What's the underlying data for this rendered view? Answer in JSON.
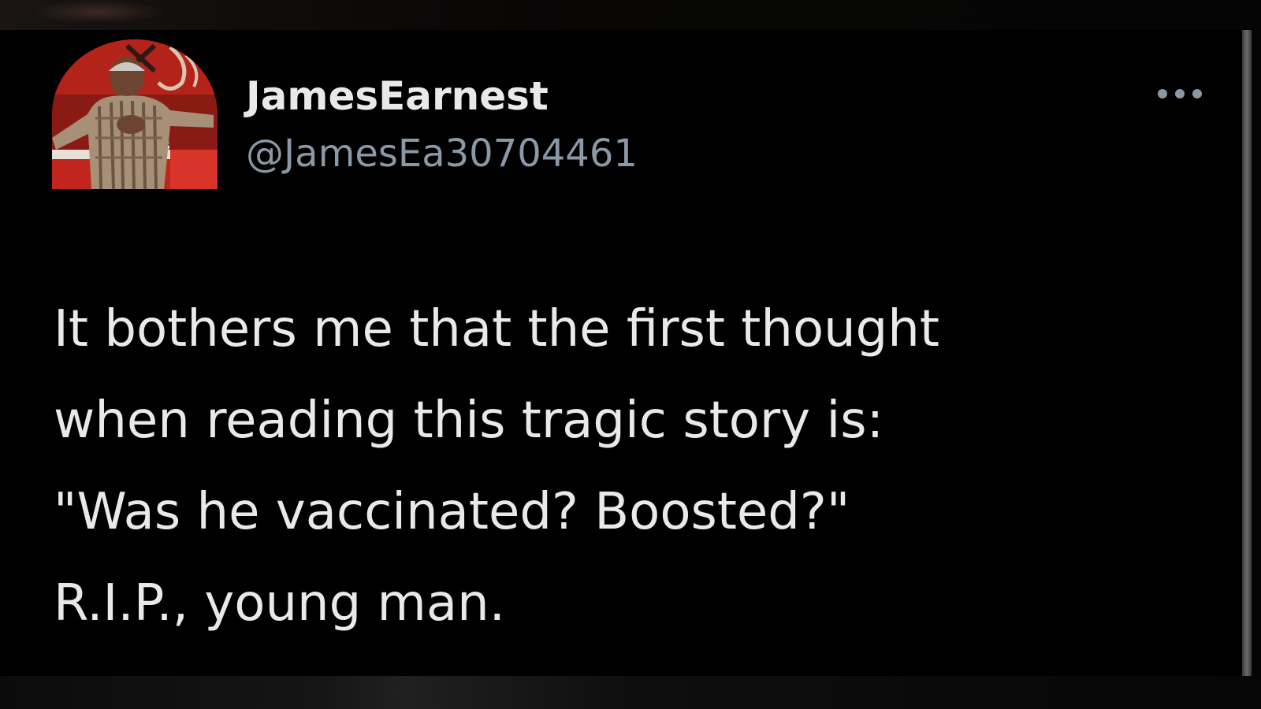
{
  "tweet": {
    "author": {
      "display_name": "JamesEarnest",
      "handle": "@JamesEa30704461",
      "avatar_icon": "profile-photo"
    },
    "more_icon": "ellipsis-icon",
    "text_lines": [
      "It bothers me that the first thought",
      "when reading this tragic story is:",
      "\"Was he vaccinated?  Boosted?\"",
      "R.I.P., young man."
    ]
  },
  "colors": {
    "background": "#000000",
    "primary_text": "#e7e9ea",
    "secondary_text": "#8b98a5"
  }
}
